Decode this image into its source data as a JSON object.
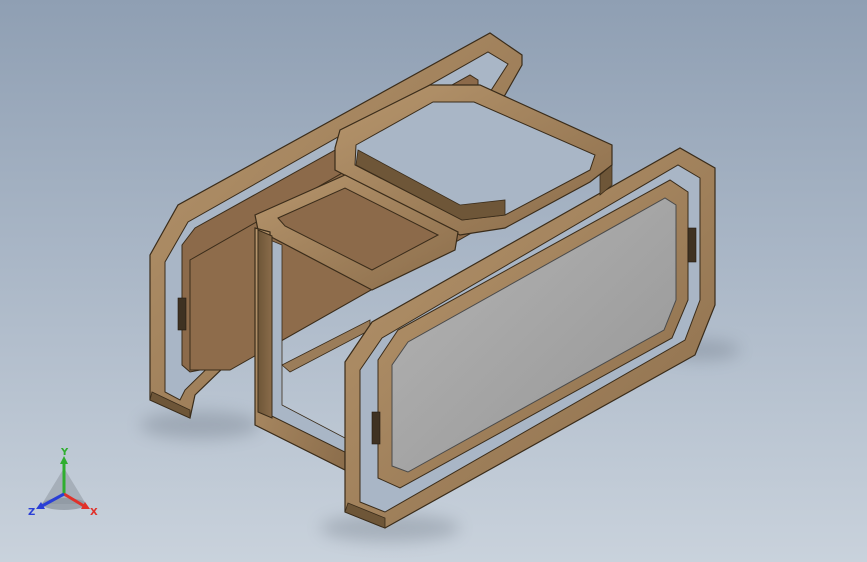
{
  "viewport": {
    "background_top": "#8f9fb3",
    "background_bottom": "#c9d2dc"
  },
  "model": {
    "frame_color": "#9b7d5a",
    "frame_dark": "#6e5638",
    "frame_light": "#c3a27a",
    "panel_color": "#8c6a4a",
    "glass_color": "#a3a3a3"
  },
  "triad": {
    "icon": "coordinate-triad-icon",
    "x_label": "X",
    "y_label": "Y",
    "z_label": "Z",
    "x_color": "#e0312a",
    "y_color": "#2fae2f",
    "z_color": "#2a3fd6"
  }
}
